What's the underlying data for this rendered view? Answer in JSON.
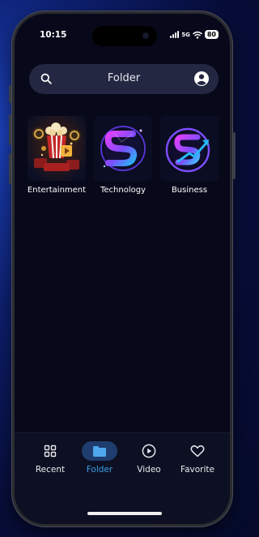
{
  "status_bar": {
    "time": "10:15",
    "network": "5G",
    "battery": "80"
  },
  "search": {
    "title": "Folder"
  },
  "categories": [
    {
      "label": "Entertainment",
      "icon": "popcorn-cinema-thumbnail"
    },
    {
      "label": "Technology",
      "icon": "s-logo-thumbnail"
    },
    {
      "label": "Business",
      "icon": "growth-logo-thumbnail"
    }
  ],
  "nav": {
    "items": [
      {
        "label": "Recent",
        "icon": "grid-icon"
      },
      {
        "label": "Folder",
        "icon": "folder-icon",
        "active": true
      },
      {
        "label": "Video",
        "icon": "play-circle-icon"
      },
      {
        "label": "Favorite",
        "icon": "heart-icon"
      }
    ]
  },
  "colors": {
    "accent": "#3ba0ea",
    "background": "#07091a",
    "search_bg": "#232741"
  }
}
